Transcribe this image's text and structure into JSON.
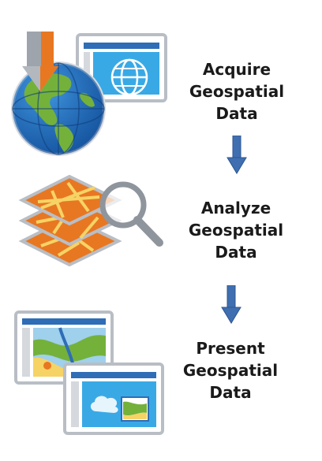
{
  "steps": [
    {
      "lines": [
        "Acquire",
        "Geospatial",
        "Data"
      ],
      "icon": "globe-download-icon"
    },
    {
      "lines": [
        "Analyze",
        "Geospatial",
        "Data"
      ],
      "icon": "layered-map-magnifier-icon"
    },
    {
      "lines": [
        "Present",
        "Geospatial",
        "Data"
      ],
      "icon": "map-windows-icon"
    }
  ],
  "colors": {
    "arrow": "#3f6fb0",
    "window_border": "#b9bec5",
    "window_bar": "#2f6db6",
    "screen": "#39a9e6",
    "map_orange": "#e87722",
    "map_yellow": "#f6d365",
    "globe_blue": "#1f6fc1",
    "land_green": "#74b13b",
    "magnifier": "#8f959c"
  }
}
